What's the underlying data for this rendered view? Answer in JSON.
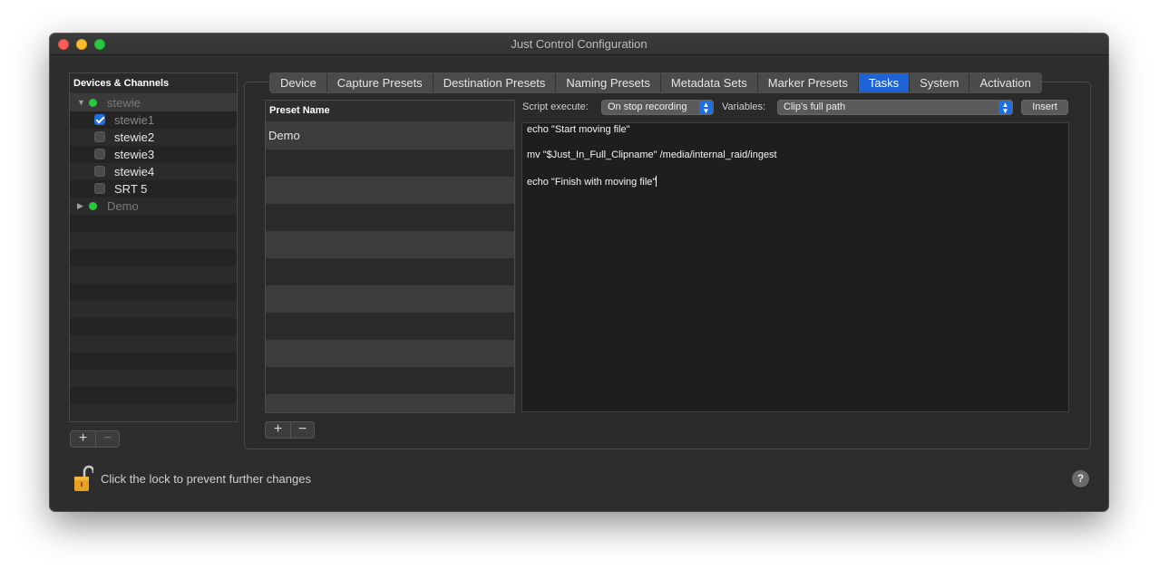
{
  "window": {
    "title": "Just Control Configuration"
  },
  "sidebar": {
    "header": "Devices & Channels",
    "groups": [
      {
        "label": "stewie",
        "expanded": true,
        "status": "online",
        "channels": [
          {
            "label": "stewie1",
            "checked": true
          },
          {
            "label": "stewie2",
            "checked": false
          },
          {
            "label": "stewie3",
            "checked": false
          },
          {
            "label": "stewie4",
            "checked": false
          },
          {
            "label": "SRT 5",
            "checked": false
          }
        ]
      },
      {
        "label": "Demo",
        "expanded": false,
        "status": "online"
      }
    ],
    "add_label": "+",
    "remove_label": "−"
  },
  "tabs": [
    "Device",
    "Capture Presets",
    "Destination Presets",
    "Naming Presets",
    "Metadata Sets",
    "Marker Presets",
    "Tasks",
    "System",
    "Activation"
  ],
  "active_tab": "Tasks",
  "presets": {
    "header": "Preset Name",
    "rows": [
      "Demo"
    ],
    "add_label": "+",
    "remove_label": "−"
  },
  "tasks": {
    "script_execute_label": "Script execute:",
    "script_execute_value": "On stop recording",
    "variables_label": "Variables:",
    "variables_value": "Clip's full path",
    "insert_label": "Insert",
    "script_lines": [
      "echo \"Start moving file\"",
      "mv \"$Just_In_Full_Clipname\" /media/internal_raid/ingest",
      "echo \"Finish with moving file\""
    ]
  },
  "footer": {
    "lock_text": "Click the lock to prevent further changes",
    "help_label": "?"
  },
  "colors": {
    "accent": "#1e63d6",
    "online": "#2ac73b",
    "window_bg": "#2d2d2d"
  }
}
